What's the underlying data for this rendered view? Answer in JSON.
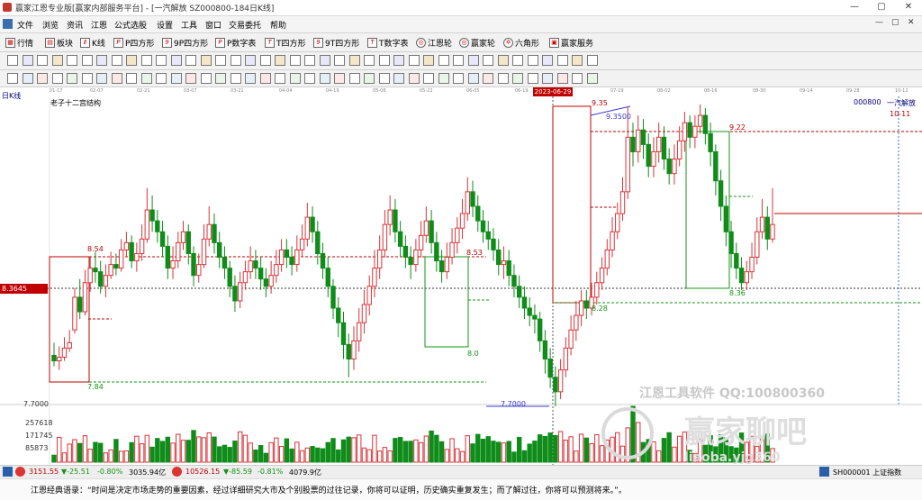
{
  "window": {
    "title": "赢家江恩专业版[赢家内部服务平台] - [一汽解放  SZ000800-184日K线]",
    "controls": [
      "—",
      "▢",
      "✕"
    ]
  },
  "menubar": {
    "items": [
      "文件",
      "浏览",
      "资讯",
      "江恩",
      "公式选股",
      "设置",
      "工具",
      "窗口",
      "交易委托",
      "帮助"
    ],
    "mdi_controls": [
      "—",
      "▢",
      "✕"
    ]
  },
  "toolbar1": {
    "items": [
      "行情",
      "板块",
      "K线",
      "P四方形",
      "9P四方形",
      "P数字表",
      "T四方形",
      "9T四方形",
      "T数字表",
      "江恩轮",
      "赢家轮",
      "六角形",
      "赢家服务"
    ]
  },
  "chart": {
    "period_label": "日K线",
    "study_name": "老子十二宫结构",
    "stock_code": "000800",
    "stock_name": "一汽解放",
    "date_marker": "10-11",
    "selected_date": "2023-06-29",
    "date_ticks": [
      "01-17",
      "02-07",
      "02-21",
      "03-07",
      "03-21",
      "04-04",
      "04-19",
      "05-08",
      "05-22",
      "06-05",
      "06-19",
      "07-19",
      "08-02",
      "08-16",
      "08-30",
      "09-14",
      "09-28",
      "10-12"
    ],
    "current_price_label": "8.3645",
    "y_axis_low": "7.7000",
    "volume_ticks": [
      "257618",
      "171745",
      "85873"
    ],
    "annotations": [
      "8.54",
      "7.84",
      "8.53",
      "9.35",
      "9.3500",
      "9.22",
      "8.28",
      "8.36",
      "8.0",
      "7.7000"
    ],
    "colors": {
      "up": "#d9343a",
      "down": "#0f8c19",
      "box_red": "#c00000",
      "box_green": "#149414"
    }
  },
  "watermarks": {
    "line1": "江恩工具软件  QQ:100800360",
    "line2": "赢家聊吧",
    "line3": "liaoba.yjg360"
  },
  "statusbar": {
    "index1_value": "3151.55",
    "index1_change": "▼-25.51",
    "index1_pct": "-0.80%",
    "index1_amount": "3035.94亿",
    "index2_value": "10526.15",
    "index2_change": "▼-85.59",
    "index2_pct": "-0.81%",
    "index2_amount": "4079.9亿",
    "right_label": "SH000001 上证指数"
  },
  "quote": {
    "text": "江恩经典语录：“时间是决定市场走势的重要因素，经过详细研究大市及个别股票的过往记录，你将可以证明，历史确实重复发生；而了解过往，你将可以预测将来。”。"
  },
  "candles": [
    [
      7.98,
      7.95,
      8.05,
      7.92
    ],
    [
      7.95,
      7.97,
      8.03,
      7.9
    ],
    [
      7.97,
      8.02,
      8.08,
      7.95
    ],
    [
      8.02,
      8.05,
      8.12,
      8.0
    ],
    [
      8.12,
      8.3,
      8.35,
      8.1
    ],
    [
      8.3,
      8.22,
      8.4,
      8.18
    ],
    [
      8.22,
      8.38,
      8.45,
      8.2
    ],
    [
      8.38,
      8.46,
      8.52,
      8.33
    ],
    [
      8.46,
      8.44,
      8.55,
      8.38
    ],
    [
      8.44,
      8.36,
      8.5,
      8.32
    ],
    [
      8.36,
      8.42,
      8.48,
      8.3
    ],
    [
      8.42,
      8.48,
      8.55,
      8.4
    ],
    [
      8.48,
      8.46,
      8.54,
      8.42
    ],
    [
      8.46,
      8.56,
      8.62,
      8.44
    ],
    [
      8.56,
      8.6,
      8.66,
      8.52
    ],
    [
      8.6,
      8.5,
      8.64,
      8.46
    ],
    [
      8.5,
      8.54,
      8.6,
      8.44
    ],
    [
      8.54,
      8.62,
      8.7,
      8.5
    ],
    [
      8.62,
      8.78,
      8.9,
      8.6
    ],
    [
      8.78,
      8.72,
      8.86,
      8.66
    ],
    [
      8.72,
      8.66,
      8.78,
      8.6
    ],
    [
      8.66,
      8.58,
      8.72,
      8.52
    ],
    [
      8.58,
      8.46,
      8.64,
      8.4
    ],
    [
      8.46,
      8.5,
      8.58,
      8.4
    ],
    [
      8.5,
      8.6,
      8.66,
      8.46
    ],
    [
      8.6,
      8.66,
      8.72,
      8.56
    ],
    [
      8.66,
      8.54,
      8.7,
      8.48
    ],
    [
      8.54,
      8.42,
      8.58,
      8.36
    ],
    [
      8.42,
      8.48,
      8.54,
      8.38
    ],
    [
      8.48,
      8.62,
      8.7,
      8.46
    ],
    [
      8.62,
      8.7,
      8.8,
      8.58
    ],
    [
      8.7,
      8.6,
      8.76,
      8.54
    ],
    [
      8.6,
      8.52,
      8.66,
      8.46
    ],
    [
      8.52,
      8.46,
      8.58,
      8.4
    ],
    [
      8.46,
      8.36,
      8.5,
      8.3
    ],
    [
      8.36,
      8.28,
      8.42,
      8.22
    ],
    [
      8.28,
      8.38,
      8.44,
      8.24
    ],
    [
      8.38,
      8.44,
      8.5,
      8.34
    ],
    [
      8.44,
      8.5,
      8.58,
      8.4
    ],
    [
      8.5,
      8.46,
      8.56,
      8.4
    ],
    [
      8.46,
      8.4,
      8.52,
      8.34
    ],
    [
      8.4,
      8.36,
      8.46,
      8.3
    ],
    [
      8.36,
      8.42,
      8.5,
      8.32
    ],
    [
      8.42,
      8.48,
      8.56,
      8.38
    ],
    [
      8.48,
      8.56,
      8.62,
      8.44
    ],
    [
      8.56,
      8.52,
      8.62,
      8.46
    ],
    [
      8.52,
      8.48,
      8.58,
      8.42
    ],
    [
      8.48,
      8.56,
      8.64,
      8.44
    ],
    [
      8.56,
      8.62,
      8.7,
      8.52
    ],
    [
      8.62,
      8.74,
      8.82,
      8.58
    ],
    [
      8.74,
      8.66,
      8.8,
      8.6
    ],
    [
      8.66,
      8.54,
      8.72,
      8.48
    ],
    [
      8.54,
      8.46,
      8.6,
      8.4
    ],
    [
      8.46,
      8.36,
      8.52,
      8.3
    ],
    [
      8.36,
      8.24,
      8.4,
      8.18
    ],
    [
      8.24,
      8.16,
      8.3,
      8.08
    ],
    [
      8.16,
      8.04,
      8.22,
      7.96
    ],
    [
      8.04,
      7.96,
      8.1,
      7.86
    ],
    [
      7.96,
      8.06,
      8.14,
      7.9
    ],
    [
      8.06,
      8.16,
      8.24,
      8.0
    ],
    [
      8.16,
      8.26,
      8.34,
      8.1
    ],
    [
      8.26,
      8.36,
      8.42,
      8.2
    ],
    [
      8.36,
      8.46,
      8.56,
      8.3
    ],
    [
      8.46,
      8.56,
      8.64,
      8.4
    ],
    [
      8.56,
      8.7,
      8.78,
      8.52
    ],
    [
      8.7,
      8.78,
      8.86,
      8.64
    ],
    [
      8.78,
      8.66,
      8.84,
      8.6
    ],
    [
      8.66,
      8.58,
      8.72,
      8.52
    ],
    [
      8.58,
      8.52,
      8.64,
      8.46
    ],
    [
      8.52,
      8.48,
      8.58,
      8.4
    ],
    [
      8.48,
      8.56,
      8.62,
      8.44
    ],
    [
      8.56,
      8.64,
      8.72,
      8.52
    ],
    [
      8.64,
      8.72,
      8.8,
      8.6
    ],
    [
      8.72,
      8.6,
      8.78,
      8.54
    ],
    [
      8.6,
      8.5,
      8.66,
      8.44
    ],
    [
      8.5,
      8.44,
      8.56,
      8.38
    ],
    [
      8.44,
      8.52,
      8.6,
      8.4
    ],
    [
      8.52,
      8.6,
      8.68,
      8.48
    ],
    [
      8.6,
      8.68,
      8.74,
      8.54
    ],
    [
      8.68,
      8.76,
      8.84,
      8.62
    ],
    [
      8.76,
      8.88,
      8.96,
      8.72
    ],
    [
      8.88,
      8.8,
      8.94,
      8.74
    ],
    [
      8.8,
      8.72,
      8.86,
      8.66
    ],
    [
      8.72,
      8.66,
      8.78,
      8.6
    ],
    [
      8.66,
      8.62,
      8.72,
      8.56
    ],
    [
      8.62,
      8.56,
      8.68,
      8.5
    ],
    [
      8.56,
      8.48,
      8.62,
      8.42
    ],
    [
      8.48,
      8.5,
      8.58,
      8.4
    ],
    [
      8.5,
      8.42,
      8.56,
      8.36
    ],
    [
      8.42,
      8.36,
      8.48,
      8.3
    ],
    [
      8.36,
      8.3,
      8.42,
      8.24
    ],
    [
      8.3,
      8.24,
      8.36,
      8.18
    ],
    [
      8.24,
      8.2,
      8.3,
      8.14
    ],
    [
      8.2,
      8.18,
      8.26,
      8.1
    ],
    [
      8.18,
      8.06,
      8.22,
      8.0
    ],
    [
      8.06,
      7.96,
      8.12,
      7.88
    ],
    [
      7.96,
      7.86,
      8.02,
      7.8
    ],
    [
      7.86,
      7.78,
      7.92,
      7.7
    ],
    [
      7.78,
      7.9,
      7.96,
      7.74
    ],
    [
      7.9,
      8.02,
      8.08,
      7.86
    ],
    [
      8.02,
      8.12,
      8.2,
      7.98
    ],
    [
      8.12,
      8.2,
      8.28,
      8.06
    ],
    [
      8.2,
      8.28,
      8.34,
      8.14
    ],
    [
      8.28,
      8.24,
      8.34,
      8.18
    ],
    [
      8.24,
      8.3,
      8.38,
      8.2
    ],
    [
      8.3,
      8.38,
      8.44,
      8.26
    ],
    [
      8.38,
      8.46,
      8.52,
      8.34
    ],
    [
      8.46,
      8.56,
      8.62,
      8.42
    ],
    [
      8.56,
      8.66,
      8.74,
      8.52
    ],
    [
      8.66,
      8.76,
      8.82,
      8.62
    ],
    [
      8.76,
      8.88,
      8.96,
      8.72
    ],
    [
      8.88,
      9.18,
      9.35,
      8.84
    ],
    [
      9.18,
      9.1,
      9.26,
      9.02
    ],
    [
      9.1,
      9.22,
      9.3,
      9.04
    ],
    [
      9.22,
      9.14,
      9.28,
      9.06
    ],
    [
      9.14,
      9.02,
      9.2,
      8.96
    ],
    [
      9.02,
      9.1,
      9.18,
      8.96
    ],
    [
      9.1,
      9.18,
      9.26,
      9.04
    ],
    [
      9.18,
      9.06,
      9.24,
      9.0
    ],
    [
      9.06,
      8.98,
      9.12,
      8.92
    ],
    [
      8.98,
      9.06,
      9.14,
      8.92
    ],
    [
      9.06,
      9.16,
      9.24,
      9.02
    ],
    [
      9.16,
      9.26,
      9.32,
      9.1
    ],
    [
      9.26,
      9.18,
      9.3,
      9.12
    ],
    [
      9.18,
      9.24,
      9.3,
      9.12
    ],
    [
      9.24,
      9.3,
      9.36,
      9.2
    ],
    [
      9.3,
      9.2,
      9.34,
      9.14
    ],
    [
      9.2,
      9.1,
      9.26,
      9.02
    ],
    [
      9.1,
      8.94,
      9.14,
      8.86
    ],
    [
      8.94,
      8.8,
      9.0,
      8.72
    ],
    [
      8.8,
      8.66,
      8.86,
      8.58
    ],
    [
      8.66,
      8.54,
      8.72,
      8.46
    ],
    [
      8.54,
      8.46,
      8.6,
      8.4
    ],
    [
      8.46,
      8.38,
      8.52,
      8.34
    ],
    [
      8.38,
      8.44,
      8.5,
      8.34
    ],
    [
      8.44,
      8.52,
      8.6,
      8.4
    ],
    [
      8.52,
      8.66,
      8.74,
      8.48
    ],
    [
      8.66,
      8.74,
      8.84,
      8.62
    ],
    [
      8.74,
      8.62,
      8.8,
      8.56
    ],
    [
      8.62,
      8.7,
      8.9,
      8.6
    ]
  ]
}
